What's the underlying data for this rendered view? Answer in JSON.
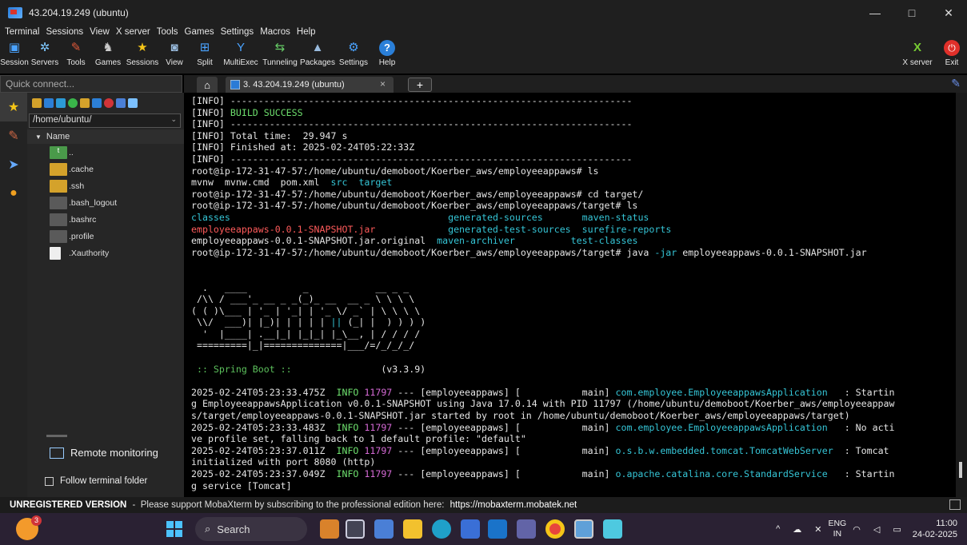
{
  "window": {
    "title": "43.204.19.249 (ubuntu)",
    "minimize": "—",
    "maximize": "□",
    "close": "✕"
  },
  "menu": [
    "Terminal",
    "Sessions",
    "View",
    "X server",
    "Tools",
    "Games",
    "Settings",
    "Macros",
    "Help"
  ],
  "toolbar": {
    "session": "Session",
    "servers": "Servers",
    "tools": "Tools",
    "games": "Games",
    "sessions": "Sessions",
    "view": "View",
    "split": "Split",
    "multiexec": "MultiExec",
    "tunneling": "Tunneling",
    "packages": "Packages",
    "settings": "Settings",
    "help": "Help",
    "xserver": "X server",
    "exit": "Exit"
  },
  "quick_connect": {
    "placeholder": "Quick connect..."
  },
  "tabs": {
    "session_tab_label": "3. 43.204.19.249 (ubuntu)",
    "close_glyph": "×",
    "new_tab_glyph": "+"
  },
  "sidebar": {
    "path": "/home/ubuntu/",
    "column_header": "Name",
    "items": [
      {
        "label": "..",
        "kind": "up"
      },
      {
        "label": ".cache",
        "kind": "folder"
      },
      {
        "label": ".ssh",
        "kind": "folder"
      },
      {
        "label": ".bash_logout",
        "kind": "file-dark"
      },
      {
        "label": ".bashrc",
        "kind": "file-dark"
      },
      {
        "label": ".profile",
        "kind": "file-dark"
      },
      {
        "label": ".Xauthority",
        "kind": "file-white"
      }
    ],
    "remote_monitoring": "Remote monitoring",
    "follow_terminal_folder": "Follow terminal folder"
  },
  "terminal": {
    "lines": [
      [
        {
          "t": "[INFO] ------------------------------------------------------------------------"
        }
      ],
      [
        {
          "t": "[INFO] "
        },
        {
          "t": "BUILD SUCCESS",
          "c": "c-green"
        }
      ],
      [
        {
          "t": "[INFO] ------------------------------------------------------------------------"
        }
      ],
      [
        {
          "t": "[INFO] Total time:  29.947 s"
        }
      ],
      [
        {
          "t": "[INFO] Finished at: 2025-02-24T05:22:33Z"
        }
      ],
      [
        {
          "t": "[INFO] ------------------------------------------------------------------------"
        }
      ],
      [
        {
          "t": "root@ip-172-31-47-57:/home/ubuntu/demoboot/Koerber_aws/employeeappaws# ls"
        }
      ],
      [
        {
          "t": "mvnw  mvnw.cmd  pom.xml  "
        },
        {
          "t": "src",
          "c": "c-cyan"
        },
        {
          "t": "  "
        },
        {
          "t": "target",
          "c": "c-cyan"
        }
      ],
      [
        {
          "t": "root@ip-172-31-47-57:/home/ubuntu/demoboot/Koerber_aws/employeeappaws# cd target/"
        }
      ],
      [
        {
          "t": "root@ip-172-31-47-57:/home/ubuntu/demoboot/Koerber_aws/employeeappaws/target# ls"
        }
      ],
      [
        {
          "t": "classes",
          "c": "c-cyan"
        },
        {
          "t": "                                       "
        },
        {
          "t": "generated-sources",
          "c": "c-cyan"
        },
        {
          "t": "       "
        },
        {
          "t": "maven-status",
          "c": "c-cyan"
        }
      ],
      [
        {
          "t": "employeeappaws-0.0.1-SNAPSHOT.jar",
          "c": "c-red"
        },
        {
          "t": "             "
        },
        {
          "t": "generated-test-sources",
          "c": "c-cyan"
        },
        {
          "t": "  "
        },
        {
          "t": "surefire-reports",
          "c": "c-cyan"
        }
      ],
      [
        {
          "t": "employeeappaws-0.0.1-SNAPSHOT.jar.original  "
        },
        {
          "t": "maven-archiver",
          "c": "c-cyan"
        },
        {
          "t": "          "
        },
        {
          "t": "test-classes",
          "c": "c-cyan"
        }
      ],
      [
        {
          "t": "root@ip-172-31-47-57:/home/ubuntu/demoboot/Koerber_aws/employeeappaws/target# java "
        },
        {
          "t": "-jar",
          "c": "c-cyan"
        },
        {
          "t": " employeeappaws-0.0.1-SNAPSHOT.jar"
        }
      ],
      [
        {
          "t": ""
        }
      ],
      [
        {
          "t": ""
        }
      ],
      [
        {
          "t": "  .   ____          _            __ _ _"
        }
      ],
      [
        {
          "t": " /\\\\ / ___'_ __ _ _(_)_ __  __ _ \\ \\ \\ \\"
        }
      ],
      [
        {
          "t": "( ( )\\___ | '_ | '_| | '_ \\/ _` | \\ \\ \\ \\"
        }
      ],
      [
        {
          "t": " \\\\/  ___)| |_)| | | | | "
        },
        {
          "t": "||",
          "c": "c-cyan"
        },
        {
          "t": " (_| |  ) ) ) )"
        }
      ],
      [
        {
          "t": "  '  |____| .__|_| |_|_| |_\\__, | / / / /"
        }
      ],
      [
        {
          "t": " =========|_|==============|___/=/_/_/_/"
        }
      ],
      [
        {
          "t": ""
        }
      ],
      [
        {
          "t": " :: Spring Boot ::",
          "c": "c-dimgreen"
        },
        {
          "t": "                (v3.3.9)"
        }
      ],
      [
        {
          "t": ""
        }
      ],
      [
        {
          "t": "2025-02-24T05:23:33.475Z  "
        },
        {
          "t": "INFO",
          "c": "c-green"
        },
        {
          "t": " "
        },
        {
          "t": "11797",
          "c": "c-magenta"
        },
        {
          "t": " --- [employeeappaws] [           main] "
        },
        {
          "t": "com.employee.EmployeeappawsApplication",
          "c": "c-cyan"
        },
        {
          "t": "   : Startin"
        }
      ],
      [
        {
          "t": "g EmployeeappawsApplication v0.0.1-SNAPSHOT using Java 17.0.14 with PID 11797 (/home/ubuntu/demoboot/Koerber_aws/employeeappaw"
        }
      ],
      [
        {
          "t": "s/target/employeeappaws-0.0.1-SNAPSHOT.jar started by root in /home/ubuntu/demoboot/Koerber_aws/employeeappaws/target)"
        }
      ],
      [
        {
          "t": "2025-02-24T05:23:33.483Z  "
        },
        {
          "t": "INFO",
          "c": "c-green"
        },
        {
          "t": " "
        },
        {
          "t": "11797",
          "c": "c-magenta"
        },
        {
          "t": " --- [employeeappaws] [           main] "
        },
        {
          "t": "com.employee.EmployeeappawsApplication",
          "c": "c-cyan"
        },
        {
          "t": "   : No acti"
        }
      ],
      [
        {
          "t": "ve profile set, falling back to 1 default profile: \"default\""
        }
      ],
      [
        {
          "t": "2025-02-24T05:23:37.011Z  "
        },
        {
          "t": "INFO",
          "c": "c-green"
        },
        {
          "t": " "
        },
        {
          "t": "11797",
          "c": "c-magenta"
        },
        {
          "t": " --- [employeeappaws] [           main] "
        },
        {
          "t": "o.s.b.w.embedded.tomcat.TomcatWebServer",
          "c": "c-cyan"
        },
        {
          "t": "  : Tomcat"
        }
      ],
      [
        {
          "t": "initialized with port 8080 (http)"
        }
      ],
      [
        {
          "t": "2025-02-24T05:23:37.049Z  "
        },
        {
          "t": "INFO",
          "c": "c-green"
        },
        {
          "t": " "
        },
        {
          "t": "11797",
          "c": "c-magenta"
        },
        {
          "t": " --- [employeeappaws] [           main] "
        },
        {
          "t": "o.apache.catalina.core.StandardService",
          "c": "c-cyan"
        },
        {
          "t": "   : Startin"
        }
      ],
      [
        {
          "t": "g service [Tomcat]"
        }
      ]
    ]
  },
  "statusbar": {
    "unregistered": "UNREGISTERED VERSION",
    "message": " -  Please support MobaXterm by subscribing to the professional edition here: ",
    "link": "https://mobaxterm.mobatek.net"
  },
  "taskbar": {
    "widget_badge": "3",
    "search": "Search",
    "lang_top": "ENG",
    "lang_bottom": "IN",
    "time": "11:00",
    "date": "24-02-2025"
  },
  "colors": {
    "accent_link": "#35c5d6",
    "success": "#6ee06e",
    "error_file": "#ff5b5b",
    "pid": "#d66ad6"
  }
}
